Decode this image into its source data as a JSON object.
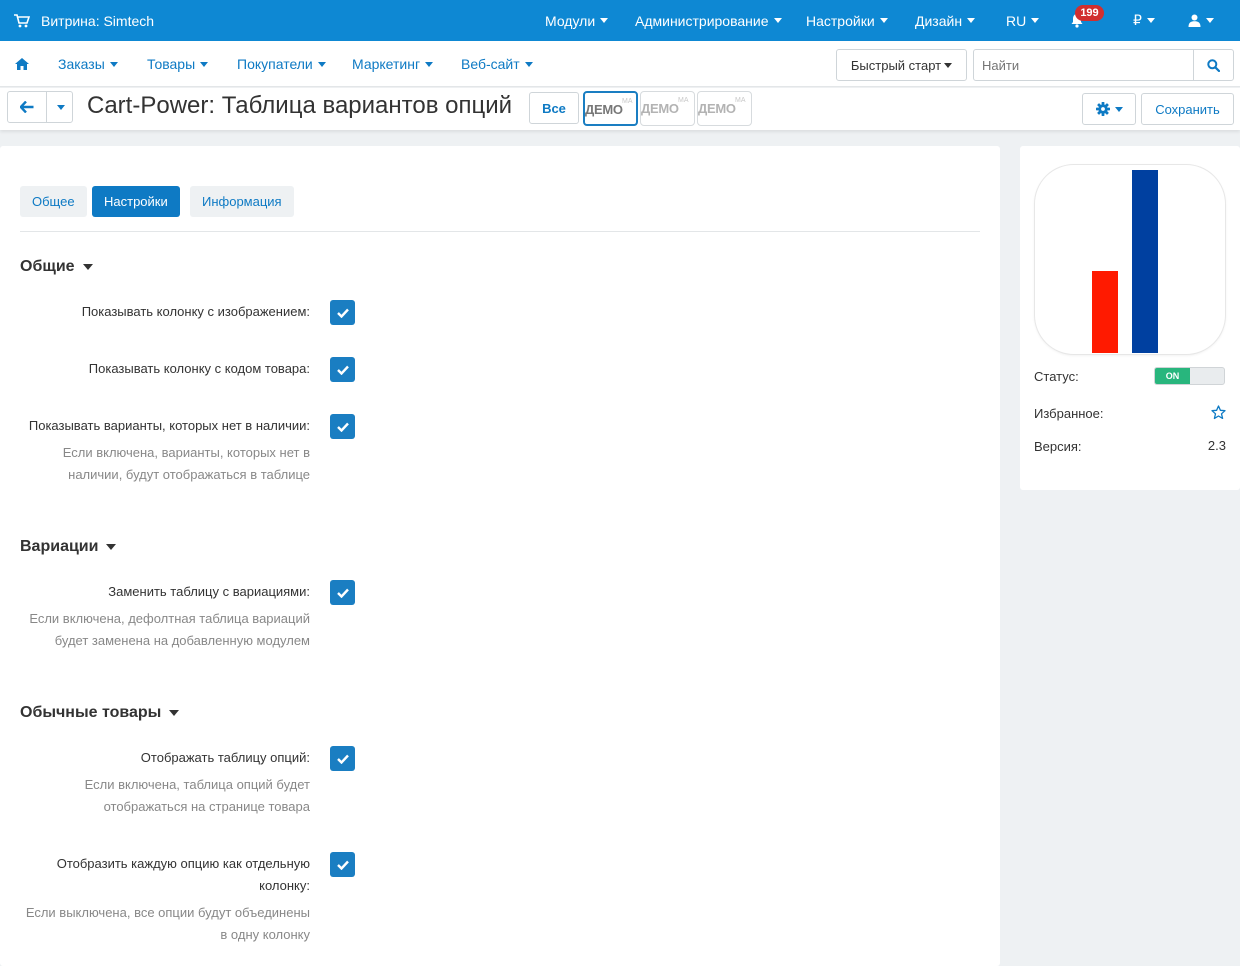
{
  "topbar": {
    "store_label": "Витрина: Simtech",
    "menu": [
      "Модули",
      "Администрирование",
      "Настройки",
      "Дизайн",
      "RU",
      "₽"
    ],
    "notifications_count": "199"
  },
  "nav": {
    "items": [
      "Заказы",
      "Товары",
      "Покупатели",
      "Маркетинг",
      "Веб-сайт"
    ],
    "quick_start": "Быстрый старт",
    "search_placeholder": "Найти"
  },
  "titlebar": {
    "title": "Cart-Power: Таблица вариантов опций",
    "all_label": "Все",
    "demo_label": "ДЕМО",
    "demo_sub": "MA",
    "save_label": "Сохранить"
  },
  "tabs": [
    {
      "label": "Общее",
      "active": false
    },
    {
      "label": "Настройки",
      "active": true
    },
    {
      "label": "Информация",
      "active": false
    }
  ],
  "sections": [
    {
      "title": "Общие"
    },
    {
      "title": "Вариации"
    },
    {
      "title": "Обычные товары"
    }
  ],
  "settings": [
    {
      "label": "Показывать колонку с изображением:",
      "checked": true
    },
    {
      "label": "Показывать колонку с кодом товара:",
      "checked": true
    },
    {
      "label": "Показывать варианты, которых нет в наличии:",
      "help1": "Если включена, варианты, которых нет в",
      "help2": "наличии, будут отображаться в таблице",
      "checked": true
    },
    {
      "label": "Заменить таблицу с вариациями:",
      "help1": "Если включена, дефолтная таблица вариаций",
      "help2": "будет заменена на добавленную модулем",
      "checked": true
    },
    {
      "label": "Отображать таблицу опций:",
      "help1": "Если включена, таблица опций будет",
      "help2": "отображаться на странице товара",
      "checked": true
    },
    {
      "label1": "Отобразить каждую опцию как отдельную",
      "label2": "колонку:",
      "help1": "Если выключена, все опции будут объединены",
      "help2": "в одну колонку",
      "checked": true
    }
  ],
  "sidebar": {
    "status_label": "Статус:",
    "status_value": "ON",
    "favorite_label": "Избранное:",
    "version_label": "Версия:",
    "version_value": "2.3",
    "logo_colors": {
      "red": "#ff1a00",
      "blue": "#0040a0"
    },
    "logo_bars": [
      0.45,
      1.0
    ]
  },
  "colors": {
    "topbar": "#0e88d3",
    "accent": "#0e7ac4",
    "checkbox": "#1a7ec2",
    "toggle_on": "#28b67d",
    "badge": "#d12f2f"
  }
}
